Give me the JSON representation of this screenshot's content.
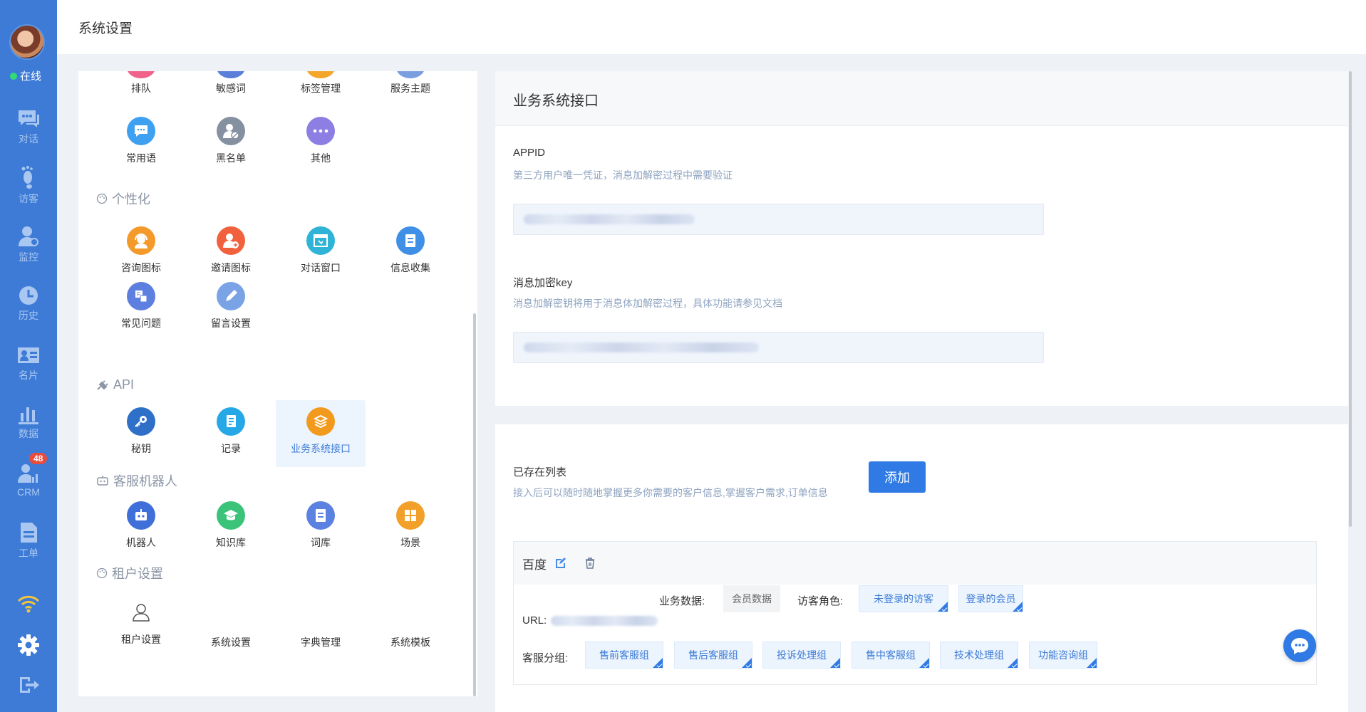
{
  "header": {
    "title": "系统设置"
  },
  "nav": {
    "status": "在线",
    "items": [
      {
        "label": "对话",
        "icon": "chat-icon"
      },
      {
        "label": "访客",
        "icon": "footprint-icon"
      },
      {
        "label": "监控",
        "icon": "monitor-icon"
      },
      {
        "label": "历史",
        "icon": "clock-icon"
      },
      {
        "label": "名片",
        "icon": "card-icon"
      },
      {
        "label": "数据",
        "icon": "bar-chart-icon"
      },
      {
        "label": "CRM",
        "icon": "crm-icon",
        "badge": "48"
      },
      {
        "label": "工单",
        "icon": "document-icon"
      }
    ],
    "bottom_icons": [
      "wifi-icon",
      "gear-icon",
      "logout-icon"
    ]
  },
  "settings": {
    "top_row": [
      "排队",
      "敏感词",
      "标签管理",
      "服务主题"
    ],
    "row2": [
      "常用语",
      "黑名单",
      "其他"
    ],
    "sections": [
      {
        "title": "个性化",
        "items": [
          "咨询图标",
          "邀请图标",
          "对话窗口",
          "信息收集",
          "常见问题",
          "留言设置"
        ]
      },
      {
        "title": "API",
        "items": [
          "秘钥",
          "记录",
          "业务系统接口"
        ]
      },
      {
        "title": "客服机器人",
        "items": [
          "机器人",
          "知识库",
          "词库",
          "场景"
        ]
      },
      {
        "title": "租户设置",
        "items": [
          "租户设置",
          "系统设置",
          "字典管理",
          "系统模板"
        ]
      }
    ],
    "active": "业务系统接口"
  },
  "api_card": {
    "title": "业务系统接口",
    "appid_label": "APPID",
    "appid_desc": "第三方用户唯一凭证，消息加解密过程中需要验证",
    "key_label": "消息加密key",
    "key_desc": "消息加解密钥将用于消息体加解密过程，具体功能请参见文档"
  },
  "list_card": {
    "title": "已存在列表",
    "desc": "接入后可以随时随地掌握更多你需要的客户信息,掌握客户需求,订单信息",
    "add_button": "添加",
    "entry": {
      "name": "百度",
      "url_label": "URL:",
      "biz_label": "业务数据:",
      "biz_value": "会员数据",
      "role_label": "访客角色:",
      "roles": [
        "未登录的访客",
        "登录的会员"
      ],
      "group_label": "客服分组:",
      "groups": [
        "售前客服组",
        "售后客服组",
        "投诉处理组",
        "售中客服组",
        "技术处理组",
        "功能咨询组"
      ]
    }
  },
  "colors": {
    "primary": "#2f7ae5",
    "nav_bg": "#3d7bd6",
    "badge": "#e84c3d",
    "online": "#2fdc77"
  }
}
